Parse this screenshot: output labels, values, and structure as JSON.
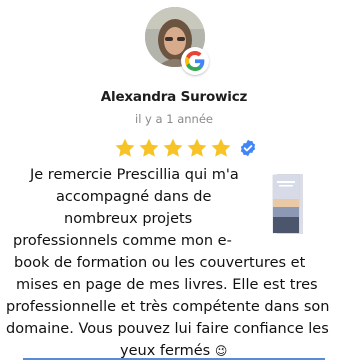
{
  "reviewer": {
    "name": "Alexandra Surowicz",
    "time_ago": "il y a 1 année",
    "avatar_icon": "reviewer-photo",
    "source_icon": "google-g-icon"
  },
  "rating": {
    "stars": 5,
    "max": 5,
    "star_color": "#f7c325",
    "verified_icon": "verified-check-icon",
    "verified_color": "#4285f4"
  },
  "review": {
    "lines": [
      "Je remercie Prescillia qui m'a",
      "accompagné dans de",
      "nombreux projets",
      "professionnels comme mon e-",
      "book de formation ou les couvertures et",
      "mises en page de mes livres. Elle est tres",
      "professionnelle et très compétente dans son",
      "domaine. Vous pouvez lui faire confiance les",
      "yeux fermés"
    ],
    "emoji": "😉",
    "image_icon": "ebook-cover-image"
  }
}
